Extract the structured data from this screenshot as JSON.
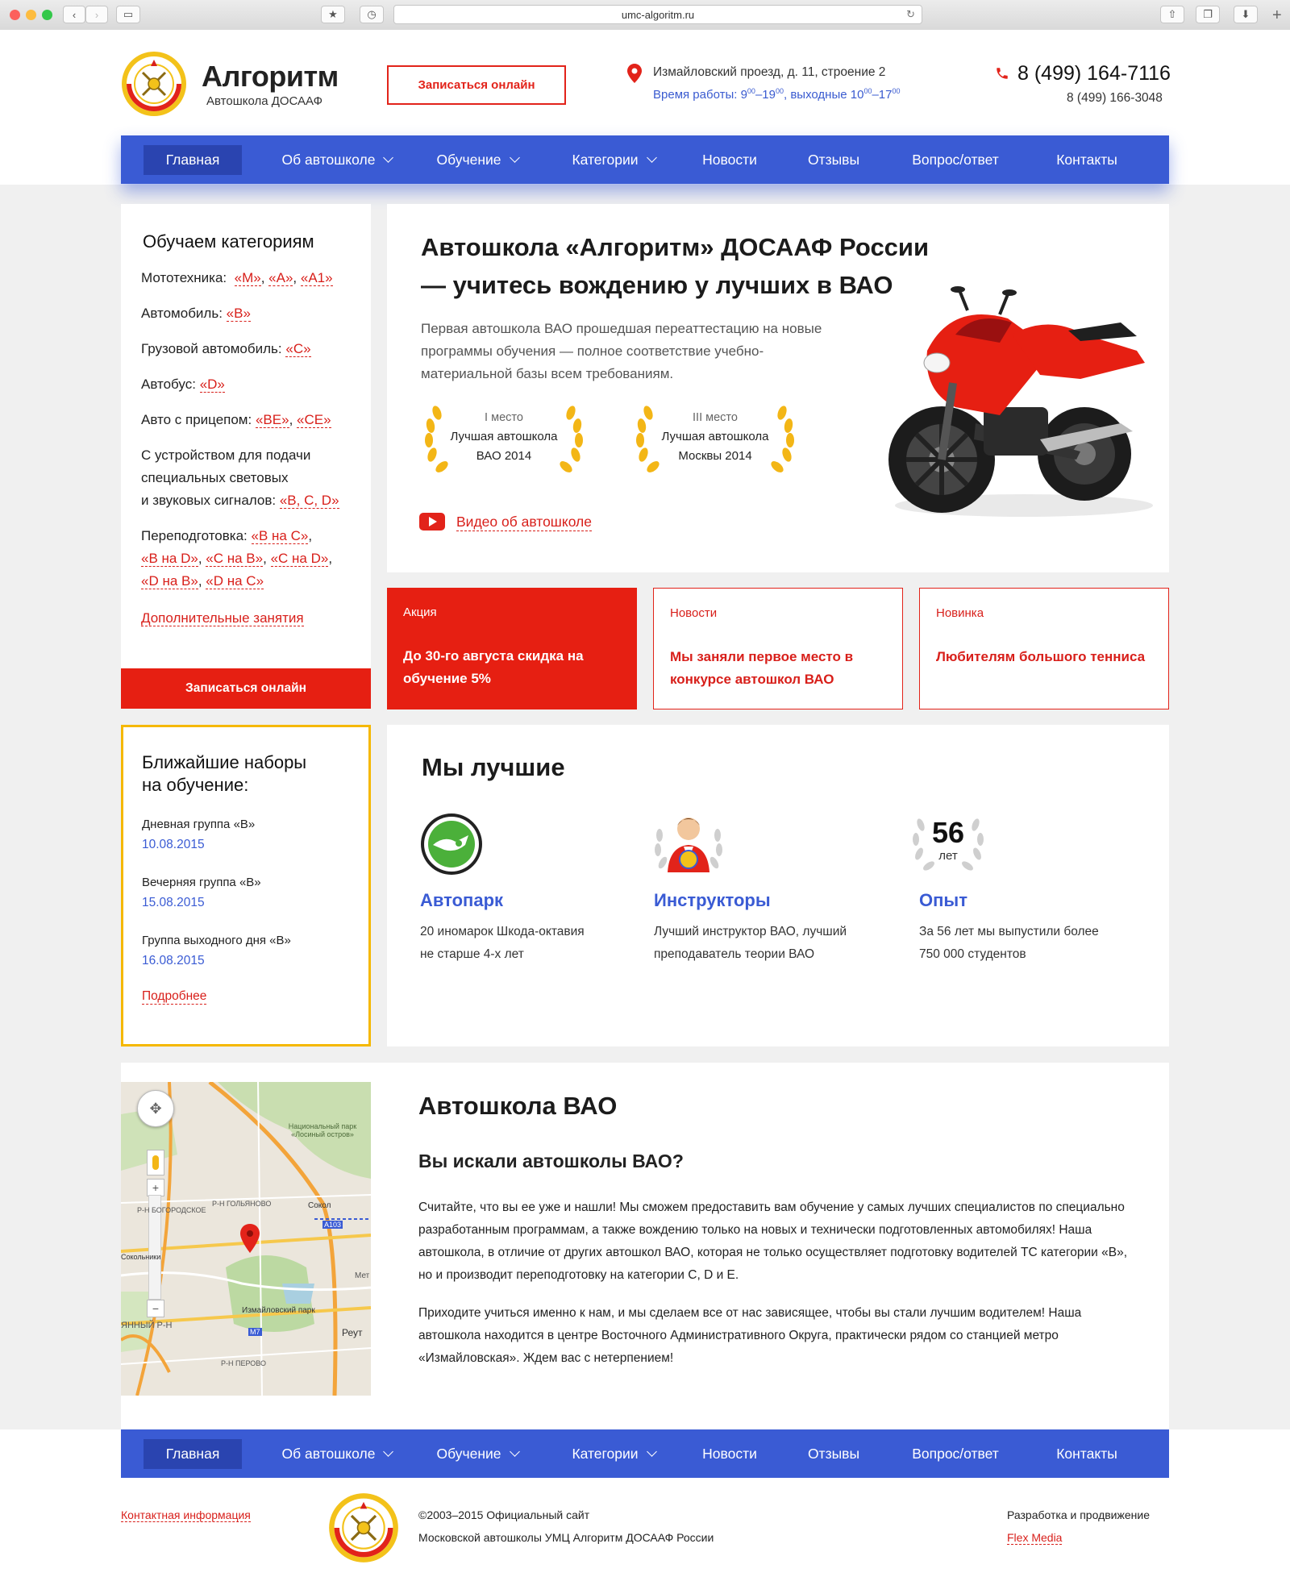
{
  "browser": {
    "url": "umc-algoritm.ru"
  },
  "header": {
    "logo_title": "Алгоритм",
    "logo_sub": "Автошкола ДОСААФ",
    "signup_button": "Записаться онлайн",
    "address": "Измайловский проезд, д. 11, строение 2",
    "hours_prefix": "Время работы: 9",
    "hours_sup1": "00",
    "hours_mid": "–19",
    "hours_sup2": "00",
    "hours_weekend": ", выходные 10",
    "hours_sup3": "00",
    "hours_end": "–17",
    "hours_sup4": "00",
    "phone_main": "8 (499) 164-7116",
    "phone_second": "8 (499) 166-3048"
  },
  "nav": [
    {
      "label": "Главная",
      "dropdown": false,
      "active": true
    },
    {
      "label": "Об автошколе",
      "dropdown": true
    },
    {
      "label": "Обучение",
      "dropdown": true
    },
    {
      "label": "Категории",
      "dropdown": true
    },
    {
      "label": "Новости",
      "dropdown": false
    },
    {
      "label": "Отзывы",
      "dropdown": false
    },
    {
      "label": "Вопрос/ответ",
      "dropdown": false
    },
    {
      "label": "Контакты",
      "dropdown": false
    }
  ],
  "sidebar": {
    "title": "Обучаем категориям",
    "moto_label": "Мототехника:",
    "moto_links": [
      "«M»",
      "«A»",
      "«A1»"
    ],
    "car_label": "Автомобиль:",
    "car_link": "«B»",
    "truck_label": "Грузовой автомобиль:",
    "truck_link": "«C»",
    "bus_label": "Автобус:",
    "bus_link": "«D»",
    "trailer_label": "Авто с прицепом:",
    "trailer_links": [
      "«BE»",
      "«CE»"
    ],
    "special_line1": "С устройством для подачи",
    "special_line2": "специальных световых",
    "special_line3": "и звуковых сигналов:",
    "special_link": "«B, C, D»",
    "retrain_label": "Переподготовка:",
    "retrain_links": [
      "«B на C»",
      "«B на D»",
      "«C на B»",
      "«C на D»",
      "«D на B»",
      "«D на C»"
    ],
    "extra_link": "Дополнительные занятия",
    "signup_button": "Записаться онлайн"
  },
  "hero": {
    "title_line1": "Автошкола «Алгоритм» ДОСААФ России",
    "title_line2": "— учитесь вождению у лучших в ВАО",
    "text": "Первая автошкола ВАО прошедшая переаттестацию на новые программы обучения — полное соответствие учебно-материальной базы всем требованиям.",
    "awards": [
      {
        "place": "I место",
        "line1": "Лучшая автошкола",
        "line2": "ВАО 2014"
      },
      {
        "place": "III место",
        "line1": "Лучшая автошкола",
        "line2": "Москвы 2014"
      }
    ],
    "video_link": "Видео об автошколе"
  },
  "promos": [
    {
      "tag": "Акция",
      "text": "До 30-го августа скидка на обучение 5%",
      "filled": true
    },
    {
      "tag": "Новости",
      "text": "Мы заняли первое место в конкурсе автошкол ВАО",
      "filled": false
    },
    {
      "tag": "Новинка",
      "text": "Любителям большого тенниса",
      "filled": false
    }
  ],
  "enrollment": {
    "title_line1": "Ближайшие наборы",
    "title_line2": "на обучение:",
    "groups": [
      {
        "name": "Дневная группа «B»",
        "date": "10.08.2015"
      },
      {
        "name": "Вечерняя группа «B»",
        "date": "15.08.2015"
      },
      {
        "name": "Группа выходного дня «B»",
        "date": "16.08.2015"
      }
    ],
    "more_link": "Подробнее"
  },
  "best": {
    "title": "Мы лучшие",
    "experience_number": "56",
    "experience_unit": "лет",
    "items": [
      {
        "heading": "Автопарк",
        "line1": "20 иномарок Шкода-октавия",
        "line2": "не старше 4-х лет"
      },
      {
        "heading": "Инструкторы",
        "line1": "Лучший инструктор ВАО, лучший",
        "line2": "преподаватель теории ВАО"
      },
      {
        "heading": "Опыт",
        "line1": "За 56 лет мы выпустили более",
        "line2": "750 000 студентов"
      }
    ]
  },
  "map": {
    "labels": {
      "park": "Национальный парк «Лосиный остров»",
      "golyanovo": "Р-Н ГОЛЬЯНОВО",
      "bogorodskoe": "Р-Н БОГОРОДСКОЕ",
      "sokolniki_small": "Сокольники",
      "sokol": "Сокол",
      "a103": "A103",
      "izm_park": "Измайловский парк",
      "m7": "M7",
      "reut": "Реут",
      "perovo": "Р-Н ПЕРОВО",
      "yanny": "ЯННЫЙ Р-Н",
      "meto": "Мет"
    }
  },
  "article": {
    "title": "Автошкола ВАО",
    "subtitle": "Вы искали автошколы ВАО?",
    "p1": "Считайте, что вы ее уже и нашли! Мы сможем предоставить вам обучение у самых лучших специалистов по специально разработанным программам, а также вождению только на новых и технически подготовленных автомобилях! Наша автошкола, в отличие от других автошкол ВАО, которая не только осуществляет подготовку водителей ТС категории «B», но и производит переподготовку на категории C, D и E.",
    "p2": "Приходите учиться именно к нам, и мы сделаем все от нас зависящее, чтобы вы стали лучшим водителем! Наша автошкола находится в центре Восточного Административного Округа, практически рядом со станцией метро «Измайловская». Ждем вас с нетерпением!"
  },
  "footer": {
    "contact_link": "Контактная информация",
    "copy_line1": "©2003–2015 Официальный сайт",
    "copy_line2": "Московской автошколы УМЦ Алгоритм ДОСААФ России",
    "dev_label": "Разработка и продвижение",
    "dev_link": "Flex Media"
  },
  "colors": {
    "brand_red": "#e2231a",
    "brand_blue": "#3a5bd4",
    "accent_yellow": "#f5b800"
  }
}
